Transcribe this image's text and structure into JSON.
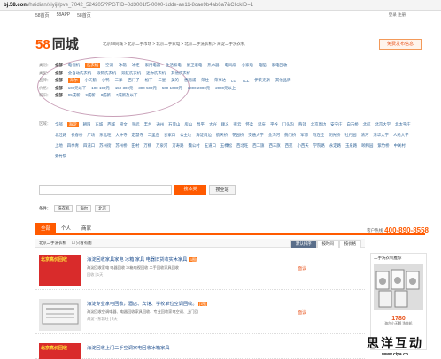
{
  "browser": {
    "domain": "bj.58.com",
    "path": "/haidian/xiyiji/pve_7042_524205/?PGTID=0d3001f5-0000-1dde-ae11-8cae9b4ab6a7&ClickID=1"
  },
  "topnav": {
    "home": "58首页",
    "app": "58APP",
    "home2": "58首页",
    "login": "登录 注册"
  },
  "header": {
    "logo_num": "58",
    "logo_cn": "同城",
    "breadcrumb": "北京58同城 > 北京二手市场 > 北京二手家电 > 北京二手洗衣机 > 海淀二手洗衣机",
    "post_button": "免费发布信息"
  },
  "filters": [
    {
      "label": "类别：",
      "items": [
        "全部",
        "电视机",
        "洗衣机",
        "空调",
        "冰箱",
        "冰柜",
        "家用电器",
        "生活家电",
        "厨卫家电",
        "热水器",
        "电风扇",
        "小家电",
        "电脑",
        "家电回收"
      ]
    },
    {
      "label": "类型：",
      "items": [
        "全部",
        "全自动洗衣机",
        "滚筒洗衣机",
        "双缸洗衣机",
        "迷你洗衣机",
        "其他洗衣机"
      ]
    },
    {
      "label": "品牌：",
      "items": [
        "全部",
        "海尔",
        "小天鹅",
        "小鸭",
        "三洋",
        "西门子",
        "松下",
        "三星",
        "美的",
        "惠而浦",
        "荣仕",
        "荣事达",
        "LG",
        "TCL",
        "伊莱克斯",
        "其他品牌"
      ]
    },
    {
      "label": "价格：",
      "items": [
        "全部",
        "100元以下",
        "100-190元",
        "150-300元",
        "300-500元",
        "500-1000元",
        "1000-2000元",
        "2000元以上"
      ]
    },
    {
      "label": "新旧：",
      "items": [
        "全部",
        "95成新",
        "9成新",
        "8成新",
        "7成新及以下"
      ]
    }
  ],
  "area_label": "区域：",
  "areas": [
    "全部",
    "海淀",
    "朝阳",
    "东城",
    "西城",
    "崇文",
    "宣武",
    "丰台",
    "通州",
    "石景山",
    "房山",
    "昌平",
    "大兴",
    "顺义",
    "密云",
    "怀柔",
    "延庆",
    "平谷",
    "门头沟",
    "燕郊",
    "北京周边",
    "安宁庄",
    "白石桥",
    "北航",
    "北京大学",
    "北太平庄",
    "北洼路",
    "长春桥",
    "广场",
    "东北旺",
    "大钟寺",
    "定慧寺",
    "二里庄",
    "甘家口",
    "公主坟",
    "海淀周边",
    "航天桥",
    "花园桥",
    "交通大学",
    "金沟河",
    "蓟门桥",
    "军博",
    "马连洼",
    "明光桥",
    "牡丹园",
    "清河",
    "清华大学",
    "人民大学",
    "上地",
    "四季青",
    "四道口",
    "苏州街",
    "苏州桥",
    "田村",
    "万柳",
    "万泉河",
    "万寿路",
    "魏公村",
    "五道口",
    "五棵松",
    "西北旺",
    "西二旗",
    "西三旗",
    "西苑",
    "小西天",
    "学院路",
    "永定路",
    "玉泉路",
    "颐和园",
    "紫竹桥",
    "中关村",
    "紫竹院"
  ],
  "search": {
    "placeholder": "",
    "search_button": "搜本类",
    "publish_button": "搜全站"
  },
  "conditions": {
    "label": "条件：",
    "items": [
      "洗衣机",
      "海尔",
      "北京"
    ]
  },
  "tabs": [
    "全部",
    "个人",
    "商家"
  ],
  "phone": {
    "label": "客户热线",
    "number": "400-890-8558"
  },
  "subbar": {
    "title": "北京二手洗衣机",
    "filter": "只看有图",
    "sort": [
      "默认排序",
      "按时间",
      "按价格"
    ]
  },
  "listings": [
    {
      "thumb_text": "北京高价回收",
      "title": "海淀回收家具家电 冰箱 家具 电器旧货收实木家具",
      "tag": "[1图]",
      "desc": "海淀回收家电 电器回收 冰箱电视回收 二手回收家具回收",
      "meta": "回收 | 1天",
      "price": "面议"
    },
    {
      "thumb_text": "",
      "title": "海淀专业家电回收，酒店、宾馆、学校单位空调回收。",
      "tag": "[1图]",
      "desc": "海淀回收空调电器、电器回收家具回收、专业回收家电空调、上门回",
      "meta": "海淀 - 东北旺 | 2天",
      "price": "面议"
    },
    {
      "thumb_text": "北京高价回收",
      "title": "海淀回收上门二手空调家电回收冰箱家具",
      "tag": "",
      "desc": "",
      "meta": "",
      "price": ""
    }
  ],
  "ad": {
    "title": "二手洗衣机推荐",
    "price": "1780",
    "sub": "海尔小天鹅 洗衣机"
  },
  "watermark": {
    "big": "思洋互动",
    "small": "www.ciya.cn"
  }
}
